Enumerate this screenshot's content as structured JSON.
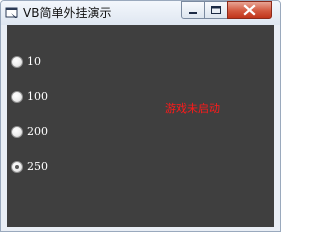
{
  "window": {
    "title": "VB简单外挂演示",
    "icon": "app-window-icon"
  },
  "colors": {
    "client_background": "#3f3f3f",
    "status_text": "#ff1a1a",
    "label_text": "#ffffff"
  },
  "options": [
    {
      "label": "10",
      "checked": false
    },
    {
      "label": "100",
      "checked": false
    },
    {
      "label": "200",
      "checked": false
    },
    {
      "label": "250",
      "checked": true
    }
  ],
  "status": {
    "text": "游戏未启动"
  }
}
